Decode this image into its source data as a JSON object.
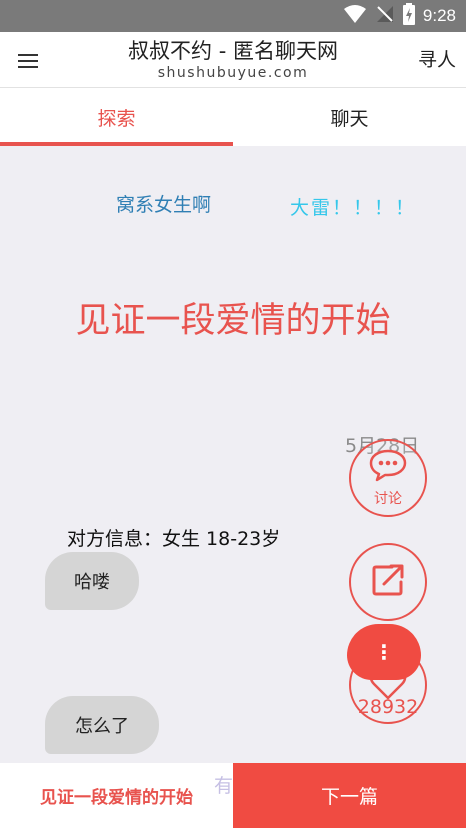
{
  "status_bar": {
    "time": "9:28"
  },
  "header": {
    "title": "叔叔不约 - 匿名聊天网",
    "subtitle": "shushubuyue.com",
    "action_label": "寻人"
  },
  "tabs": [
    {
      "label": "探索",
      "active": true
    },
    {
      "label": "聊天",
      "active": false
    }
  ],
  "post": {
    "tags": [
      "窝系女生啊",
      "大雷！！！！"
    ],
    "headline": "见证一段爱情的开始",
    "date": "5月28日",
    "partner_info": "对方信息：女生 18-23岁",
    "messages": [
      "哈喽",
      "怎么了"
    ]
  },
  "actions": {
    "discuss_label": "讨论",
    "like_count": "28932"
  },
  "bottom_bar": {
    "current_title": "见证一段爱情的开始",
    "peek_text": "有",
    "next_label": "下一篇"
  },
  "colors": {
    "accent": "#e8534e",
    "button_red": "#f04b42",
    "tag_blue": "#2f7fb4",
    "tag_cyan": "#35c7ea",
    "status_bar": "#7a7a7a"
  }
}
